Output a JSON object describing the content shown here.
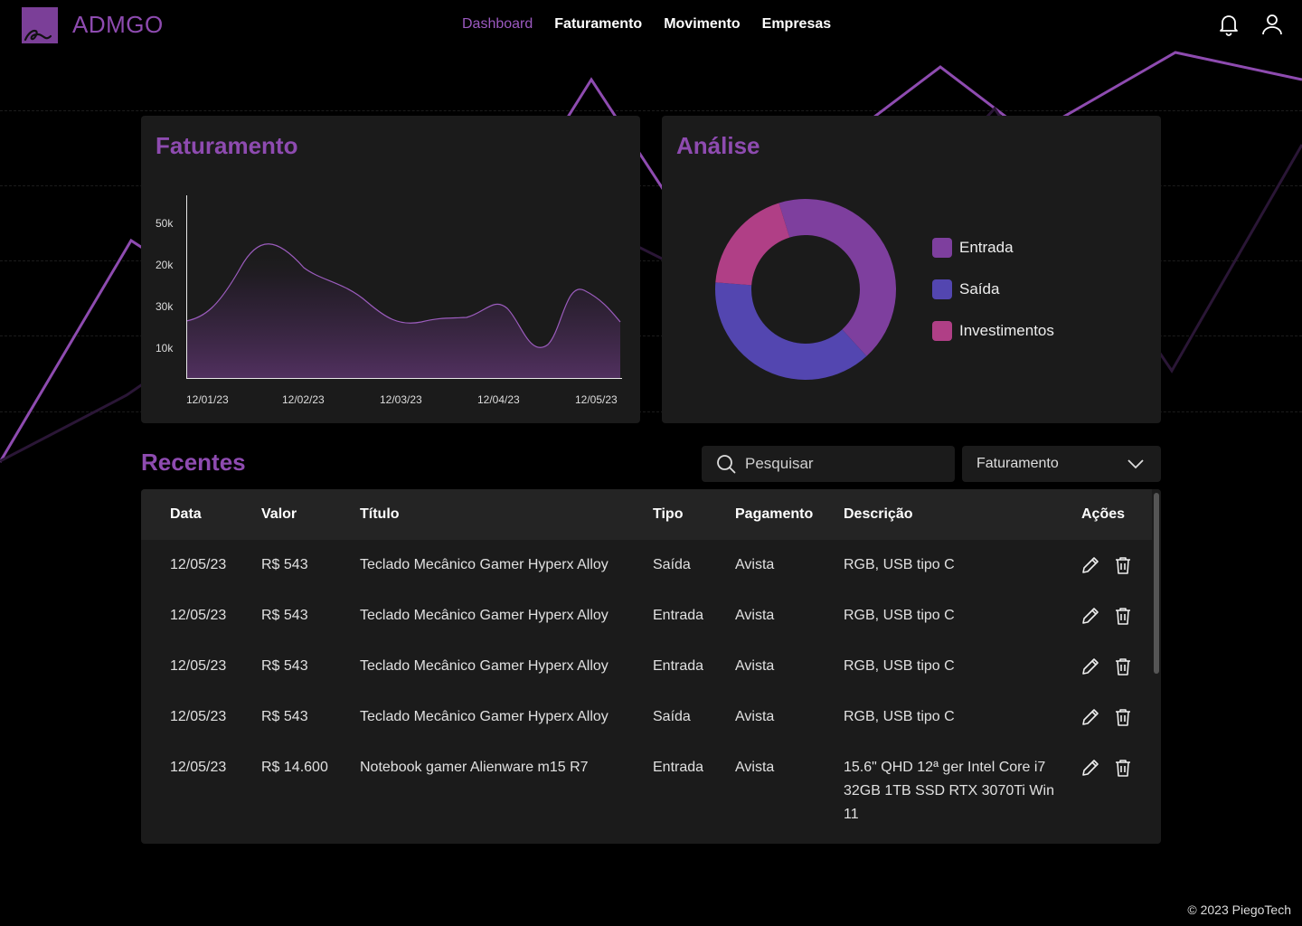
{
  "app": {
    "name": "ADMGO"
  },
  "nav": [
    {
      "label": "Dashboard",
      "active": true
    },
    {
      "label": "Faturamento",
      "active": false
    },
    {
      "label": "Movimento",
      "active": false
    },
    {
      "label": "Empresas",
      "active": false
    }
  ],
  "header_icons": [
    "bell-icon",
    "user-icon"
  ],
  "colors": {
    "accent": "#8e4bb0",
    "entrada": "#7e3f9e",
    "saida": "#5346b0",
    "investimentos": "#b03f86"
  },
  "revenue_card": {
    "title": "Faturamento",
    "chart_data": {
      "type": "area",
      "y_tick_labels": [
        "50k",
        "20k",
        "30k",
        "10k"
      ],
      "x_tick_labels": [
        "12/01/23",
        "12/02/23",
        "12/03/23",
        "12/04/23",
        "12/05/23"
      ]
    }
  },
  "analysis_card": {
    "title": "Análise",
    "chart_data": {
      "type": "pie",
      "labels": [
        "Entrada",
        "Saída",
        "Investimentos"
      ],
      "values": [
        43,
        38,
        19
      ]
    }
  },
  "recentes": {
    "title": "Recentes",
    "search_placeholder": "Pesquisar",
    "filter_value": "Faturamento",
    "columns": [
      "Data",
      "Valor",
      "Título",
      "Tipo",
      "Pagamento",
      "Descrição",
      "Ações"
    ],
    "rows": [
      {
        "data": "12/05/23",
        "valor": "R$ 543",
        "titulo": "Teclado Mecânico Gamer Hyperx Alloy",
        "tipo": "Saída",
        "pagamento": "Avista",
        "descricao": "RGB, USB tipo C"
      },
      {
        "data": "12/05/23",
        "valor": "R$ 543",
        "titulo": "Teclado Mecânico Gamer Hyperx Alloy",
        "tipo": "Entrada",
        "pagamento": "Avista",
        "descricao": "RGB, USB tipo C"
      },
      {
        "data": "12/05/23",
        "valor": "R$ 543",
        "titulo": "Teclado Mecânico Gamer Hyperx Alloy",
        "tipo": "Entrada",
        "pagamento": "Avista",
        "descricao": "RGB, USB tipo C"
      },
      {
        "data": "12/05/23",
        "valor": "R$ 543",
        "titulo": "Teclado Mecânico Gamer Hyperx Alloy",
        "tipo": "Saída",
        "pagamento": "Avista",
        "descricao": "RGB, USB tipo C"
      },
      {
        "data": "12/05/23",
        "valor": "R$ 14.600",
        "titulo": "Notebook gamer Alienware m15 R7",
        "tipo": "Entrada",
        "pagamento": "Avista",
        "descricao": "15.6\" QHD 12ª ger Intel Core i7 32GB 1TB SSD RTX 3070Ti Win 11"
      }
    ]
  },
  "footer": {
    "text": "© 2023 PiegoTech"
  }
}
